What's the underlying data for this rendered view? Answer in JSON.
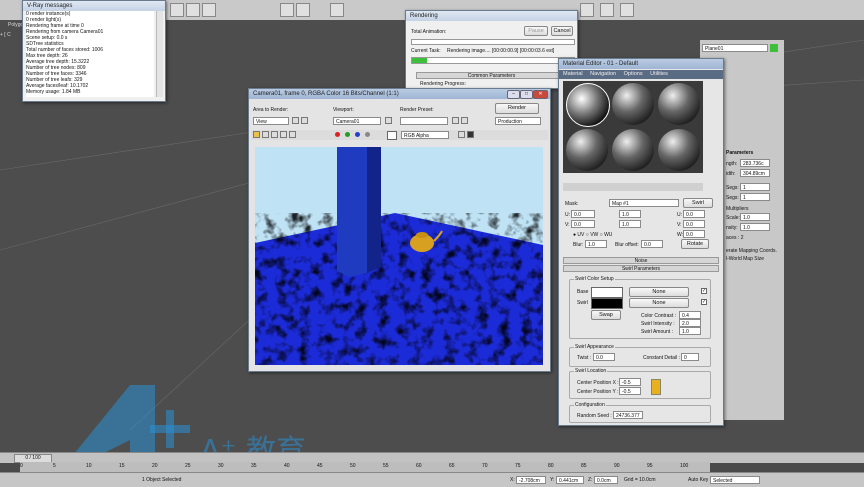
{
  "vray_messages": {
    "title": "V-Ray messages",
    "lines": [
      "0 render instance(s)",
      "0 render light(s)",
      "Rendering frame at time 0",
      "Rendering from camera Camera01",
      "Scene setup: 0.0 s",
      "SDTree statistics",
      "Total number of faces stored: 1006",
      "Max tree depth: 26",
      "Average tree depth: 15.3222",
      "Number of tree nodes: 809",
      "Number of tree faces: 3346",
      "Number of tree leafs: 329",
      "Average faces/leaf: 10.1702",
      "Memory usage: 1.84 MB"
    ]
  },
  "viewport": {
    "label": "Polygo",
    "label2": "+ [ C"
  },
  "rendering_dialog": {
    "title": "Rendering",
    "total_animation_label": "Total Animation:",
    "pause_label": "Pause",
    "cancel_label": "Cancel",
    "current_task_label": "Current Task:",
    "current_task_value": "Rendering image.... [00:00:00.9] [00:00:03.6 est]",
    "common_params": "Common Parameters",
    "render_progress": "Rendering Progress:",
    "progress": 0.09
  },
  "frame_window": {
    "title": "Camera01, frame 0, RGBA Color 16 Bits/Channel (1:1)",
    "area_to_render_label": "Area to Render:",
    "area_to_render_value": "View",
    "viewport_label": "Viewport:",
    "viewport_value": "Camera01",
    "render_preset_label": "Render Preset:",
    "render_preset_value": "",
    "render_button": "Render",
    "production_value": "Production",
    "channel_value": "RGB Alpha"
  },
  "material_editor": {
    "title": "Material Editor - 01 - Default",
    "menu": [
      "Material",
      "Navigation",
      "Options",
      "Utilities"
    ],
    "mask_label": "Mask:",
    "map_value": "Map #1",
    "swirl_label": "Swirl",
    "coords": {
      "u_label": "U:",
      "v_label": "V:",
      "w_label": "W:",
      "u_val": "0.0",
      "v_val": "0.0",
      "w_val": "0.0",
      "tile1": "1.0",
      "tile2": "1.0",
      "uv": "UV",
      "vw": "VW",
      "wu": "WU",
      "blur_label": "Blur:",
      "blur_val": "1.0",
      "blur_offset_label": "Blur offset:",
      "blur_offset_val": "0.0",
      "rotate_label": "Rotate"
    },
    "noise_rollout": "Noise",
    "swirl_params_rollout": "Swirl Parameters",
    "swirl_color_setup": "Swirl Color Setup",
    "base_label": "Base",
    "swirl_color_label": "Swirl",
    "none1": "None",
    "none2": "None",
    "swap_label": "Swap",
    "color_contrast_label": "Color Contrast :",
    "color_contrast_val": "0.4",
    "swirl_intensity_label": "Swirl Intensity :",
    "swirl_intensity_val": "2.0",
    "swirl_amount_label": "Swirl Amount :",
    "swirl_amount_val": "1.0",
    "swirl_appearance": "Swirl Appearance",
    "twist_label": "Twist :",
    "twist_val": "0.0",
    "constant_detail_label": "Constant Detail :",
    "constant_detail_val": "0",
    "swirl_location": "Swirl Location",
    "center_x_label": "Center Position X :",
    "center_x_val": "-0.5",
    "center_y_label": "Center Position Y :",
    "center_y_val": "-0.5",
    "configuration": "Configuration",
    "random_seed_label": "Random Seed :",
    "random_seed_val": "24736.377"
  },
  "command_panel": {
    "object_name": "Plane01",
    "params_title": "Parameters",
    "length_label": "ngth:",
    "length_val": "283.736c",
    "width_label": "idth:",
    "width_val": "304.89cm",
    "lsegs_label": "Segs:",
    "lsegs_val": "1",
    "wsegs_label": "Segs:",
    "wsegs_val": "1",
    "multipliers": "Multipliers",
    "scale_label": "Scale:",
    "scale_val": "1.0",
    "density_label": "nsity:",
    "density_val": "1.0",
    "faces_label": "aces : 2",
    "gen_mapping": "erate Mapping Coords.",
    "real_world": "l-World Map Size"
  },
  "timeline": {
    "range": "0 / 100",
    "ticks": [
      "0",
      "5",
      "10",
      "15",
      "20",
      "25",
      "30",
      "35",
      "40",
      "45",
      "50",
      "55",
      "60",
      "65",
      "70",
      "75",
      "80",
      "85",
      "90",
      "95",
      "100"
    ]
  },
  "statusbar": {
    "selected": "1 Object Selected",
    "x_label": "X:",
    "x_val": "-2.708cm",
    "y_label": "Y:",
    "y_val": "0.441cm",
    "z_label": "Z:",
    "z_val": "0.0cm",
    "grid": "Grid = 10.0cm",
    "autokey": "Auto Key",
    "selected_dd": "Selected"
  },
  "watermark": {
    "text": "A⁺ 教育"
  },
  "colors": {
    "accent_green": "#3cc03c",
    "watermark_blue": "#2a8fd6"
  }
}
